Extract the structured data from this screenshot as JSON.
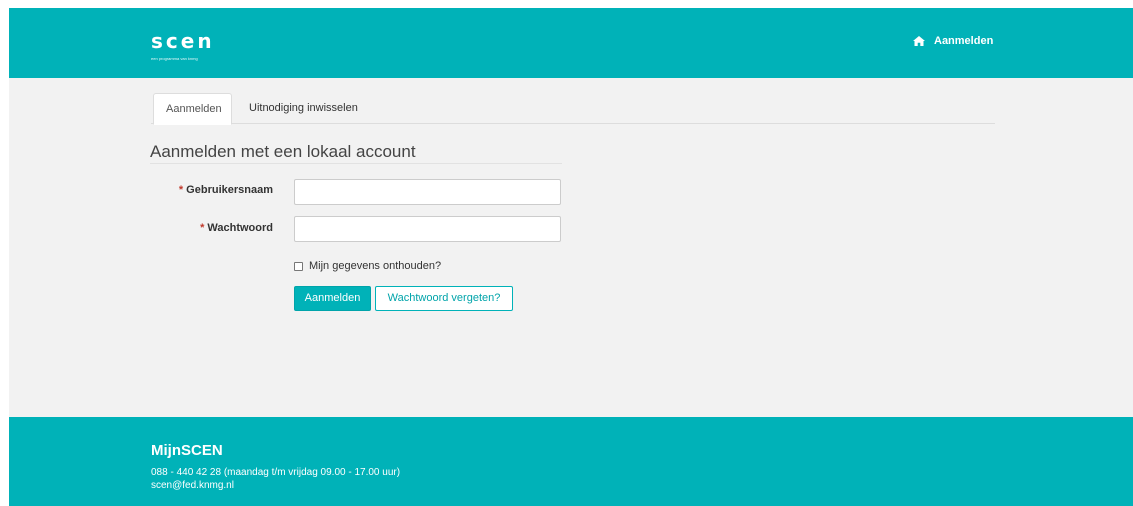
{
  "header": {
    "logo_text": "scen",
    "logo_tagline": "een programma van knmg",
    "nav_login_label": "Aanmelden",
    "nav_icon": "home-icon"
  },
  "tabs": [
    {
      "label": "Aanmelden",
      "active": true
    },
    {
      "label": "Uitnodiging inwisselen",
      "active": false
    }
  ],
  "form": {
    "title": "Aanmelden met een lokaal account",
    "required_marker": "*",
    "username_label": "Gebruikersnaam",
    "username_value": "",
    "password_label": "Wachtwoord",
    "password_value": "",
    "remember_label": "Mijn gegevens onthouden?",
    "remember_checked": false,
    "submit_label": "Aanmelden",
    "forgot_label": "Wachtwoord vergeten?"
  },
  "footer": {
    "title": "MijnSCEN",
    "phone": "088 - 440 42 28 (maandag t/m vrijdag 09.00 - 17.00 uur)",
    "email": "scen@fed.knmg.nl"
  },
  "colors": {
    "brand": "#00b2b8",
    "background": "#f2f2f2",
    "required": "#c0392b"
  }
}
